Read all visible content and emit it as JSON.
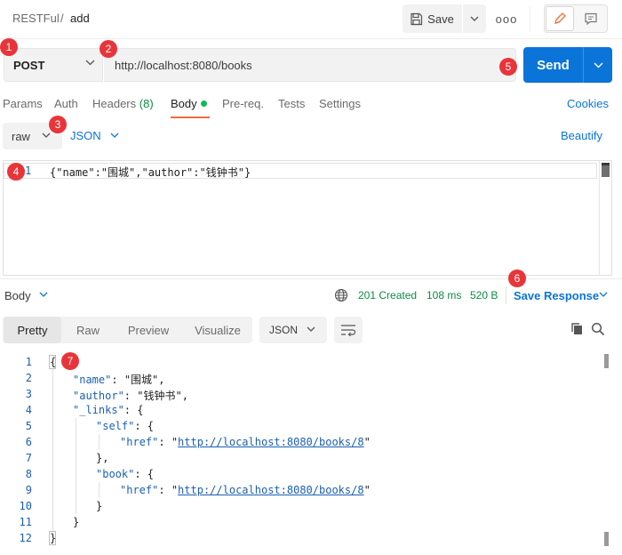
{
  "breadcrumb": {
    "parent": "RESTFul",
    "separator": "/",
    "current": "add"
  },
  "toolbar": {
    "save_label": "Save",
    "more_label": "ooo"
  },
  "request": {
    "method": "POST",
    "url": "http://localhost:8080/books",
    "send_label": "Send"
  },
  "request_tabs": {
    "params": "Params",
    "auth": "Auth",
    "headers": "Headers",
    "headers_count": "(8)",
    "body": "Body",
    "prereq": "Pre-req.",
    "tests": "Tests",
    "settings": "Settings",
    "cookies": "Cookies"
  },
  "body_mode": {
    "mode": "raw",
    "language": "JSON",
    "beautify": "Beautify"
  },
  "request_editor": {
    "line_number": "1",
    "code": "{\"name\":\"围城\",\"author\":\"钱钟书\"}"
  },
  "response": {
    "body_label": "Body",
    "status": "201 Created",
    "time": "108 ms",
    "size": "520 B",
    "save_response": "Save Response",
    "views": [
      "Pretty",
      "Raw",
      "Preview",
      "Visualize"
    ],
    "format": "JSON",
    "lines": [
      {
        "n": "1",
        "text": "{"
      },
      {
        "n": "2",
        "key": "\"name\"",
        "value": "\"围城\"",
        "tail": ","
      },
      {
        "n": "3",
        "key": "\"author\"",
        "value": "\"钱钟书\"",
        "tail": ","
      },
      {
        "n": "4",
        "key": "\"_links\"",
        "tail": ": {"
      },
      {
        "n": "5",
        "key": "\"self\"",
        "tail": ": {"
      },
      {
        "n": "6",
        "key": "\"href\"",
        "q1": "\"",
        "url": "http://localhost:8080/books/8",
        "q2": "\""
      },
      {
        "n": "7",
        "text": "},"
      },
      {
        "n": "8",
        "key": "\"book\"",
        "tail": ": {"
      },
      {
        "n": "9",
        "key": "\"href\"",
        "q1": "\"",
        "url": "http://localhost:8080/books/8",
        "q2": "\""
      },
      {
        "n": "10",
        "text": "}"
      },
      {
        "n": "11",
        "text": "}"
      },
      {
        "n": "12",
        "text": "}"
      }
    ]
  },
  "badges": [
    "1",
    "2",
    "3",
    "4",
    "5",
    "6",
    "7"
  ],
  "colors": {
    "accent": "#0a74d9",
    "success": "#0e8a44",
    "badge": "#e8353a",
    "active_tab": "#f26b3a"
  }
}
